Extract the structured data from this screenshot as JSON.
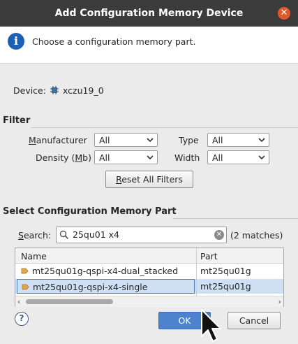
{
  "window": {
    "title": "Add Configuration Memory Device",
    "close_glyph": "✕"
  },
  "banner": {
    "icon": "info-icon",
    "text": "Choose a configuration memory part."
  },
  "device": {
    "label": "Device:",
    "value": "xczu19_0"
  },
  "filter": {
    "title": "Filter",
    "manufacturer": {
      "label_pre": "",
      "label_u": "M",
      "label_post": "anufacturer",
      "value": "All"
    },
    "type": {
      "label": "Type",
      "value": "All"
    },
    "density": {
      "label_pre": "Density (",
      "label_u": "M",
      "label_post": "b)",
      "value": "All"
    },
    "width": {
      "label": "Width",
      "value": "All"
    },
    "reset": {
      "label_u": "R",
      "label_post": "eset All Filters"
    }
  },
  "select": {
    "title": "Select Configuration Memory Part",
    "search_label_u": "S",
    "search_label_post": "earch:",
    "search_value": "25qu01 x4",
    "matches": "(2 matches)"
  },
  "table": {
    "columns": [
      "Name",
      "Part"
    ],
    "rows": [
      {
        "name": "mt25qu01g-qspi-x4-dual_stacked",
        "part": "mt25qu01g",
        "selected": false
      },
      {
        "name": "mt25qu01g-qspi-x4-single",
        "part": "mt25qu01g",
        "selected": true
      }
    ]
  },
  "footer": {
    "help": "?",
    "ok": "OK",
    "cancel": "Cancel"
  },
  "colors": {
    "titlebar": "#3b3b3b",
    "accent": "#4d82cc",
    "selection": "#cfe0f4",
    "close": "#e0592a"
  }
}
